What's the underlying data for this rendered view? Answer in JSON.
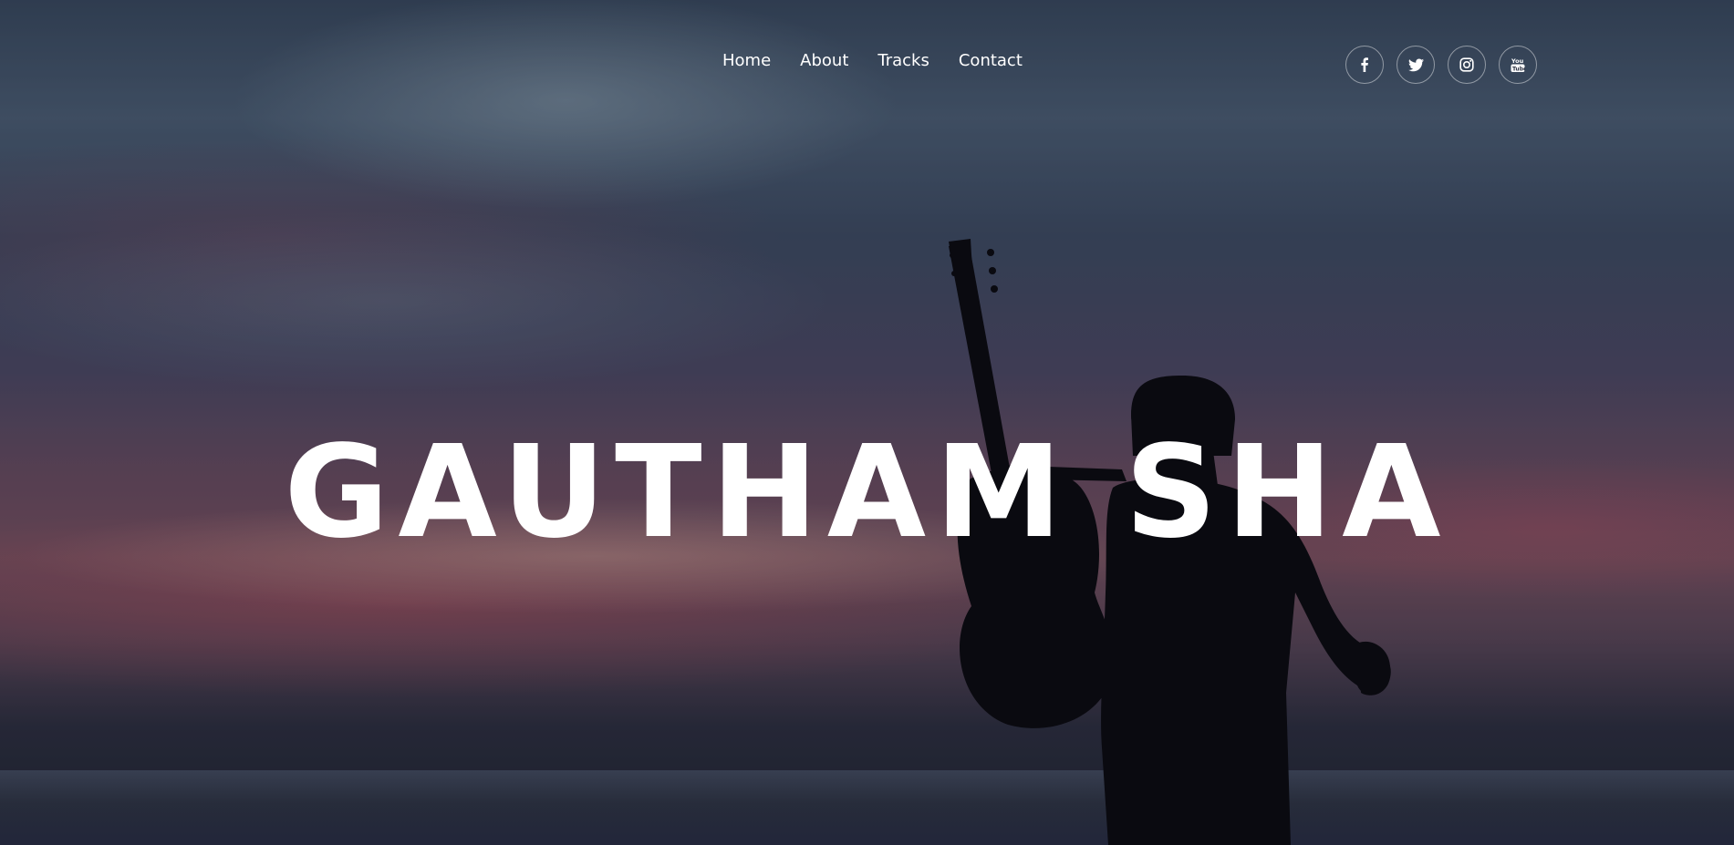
{
  "site": {
    "title": "GAUTHAM SHA"
  },
  "nav": {
    "items": [
      {
        "label": "Home"
      },
      {
        "label": "About"
      },
      {
        "label": "Tracks"
      },
      {
        "label": "Contact"
      }
    ]
  },
  "social": {
    "items": [
      {
        "icon": "facebook-icon"
      },
      {
        "icon": "twitter-icon"
      },
      {
        "icon": "instagram-icon"
      },
      {
        "icon": "youtube-icon"
      }
    ]
  },
  "colors": {
    "text": "#ffffff",
    "silhouette": "#0a0a10"
  }
}
